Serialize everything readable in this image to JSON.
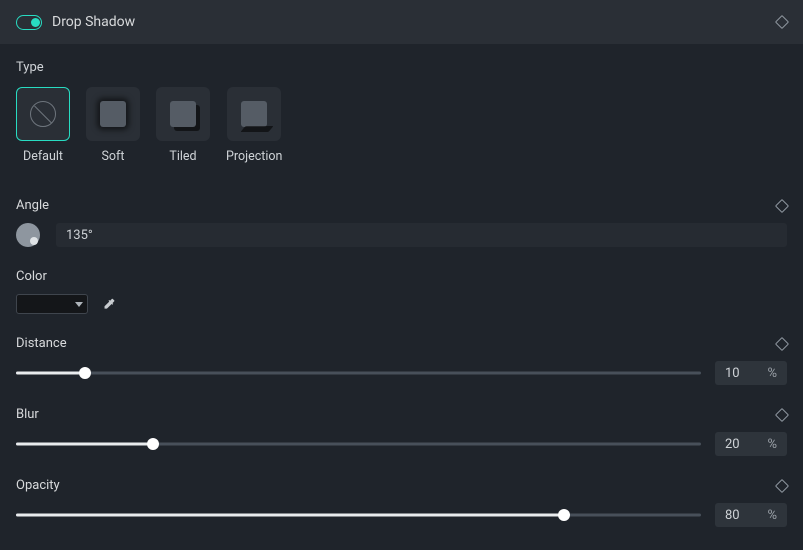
{
  "header": {
    "title": "Drop Shadow",
    "enabled": true
  },
  "type": {
    "label": "Type",
    "options": [
      "Default",
      "Soft",
      "Tiled",
      "Projection"
    ],
    "selected": "Default"
  },
  "angle": {
    "label": "Angle",
    "value": "135°"
  },
  "color": {
    "label": "Color",
    "value_hex": "#000000"
  },
  "distance": {
    "label": "Distance",
    "value": "10",
    "unit": "%",
    "percent": 10
  },
  "blur": {
    "label": "Blur",
    "value": "20",
    "unit": "%",
    "percent": 20
  },
  "opacity": {
    "label": "Opacity",
    "value": "80",
    "unit": "%",
    "percent": 80
  },
  "icons": {
    "keyframe": "keyframe-icon",
    "eyedropper": "eyedropper-icon",
    "chevron_down": "chevron-down-icon"
  }
}
